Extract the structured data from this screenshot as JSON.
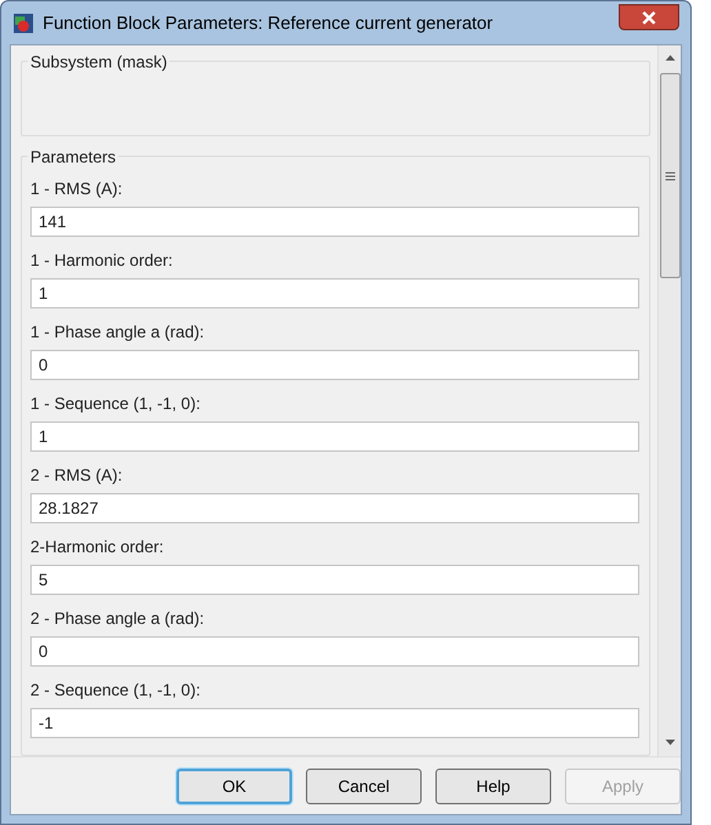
{
  "window": {
    "title": "Function Block Parameters: Reference current generator"
  },
  "description_group": {
    "title": "Subsystem (mask)"
  },
  "parameters_group": {
    "title": "Parameters"
  },
  "parameters": [
    {
      "label": "1 - RMS (A):",
      "value": "141"
    },
    {
      "label": "1 - Harmonic order:",
      "value": "1"
    },
    {
      "label": "1 - Phase angle a (rad):",
      "value": "0"
    },
    {
      "label": "1 - Sequence (1, -1, 0):",
      "value": "1"
    },
    {
      "label": "2 - RMS (A):",
      "value": "28.1827"
    },
    {
      "label": "2-Harmonic order:",
      "value": "5"
    },
    {
      "label": "2 - Phase angle a (rad):",
      "value": "0"
    },
    {
      "label": "2 - Sequence (1, -1, 0):",
      "value": "-1"
    }
  ],
  "buttons": [
    {
      "label": "OK",
      "disabled": false,
      "default": true
    },
    {
      "label": "Cancel",
      "disabled": false,
      "default": false
    },
    {
      "label": "Help",
      "disabled": false,
      "default": false
    },
    {
      "label": "Apply",
      "disabled": true,
      "default": false
    }
  ]
}
